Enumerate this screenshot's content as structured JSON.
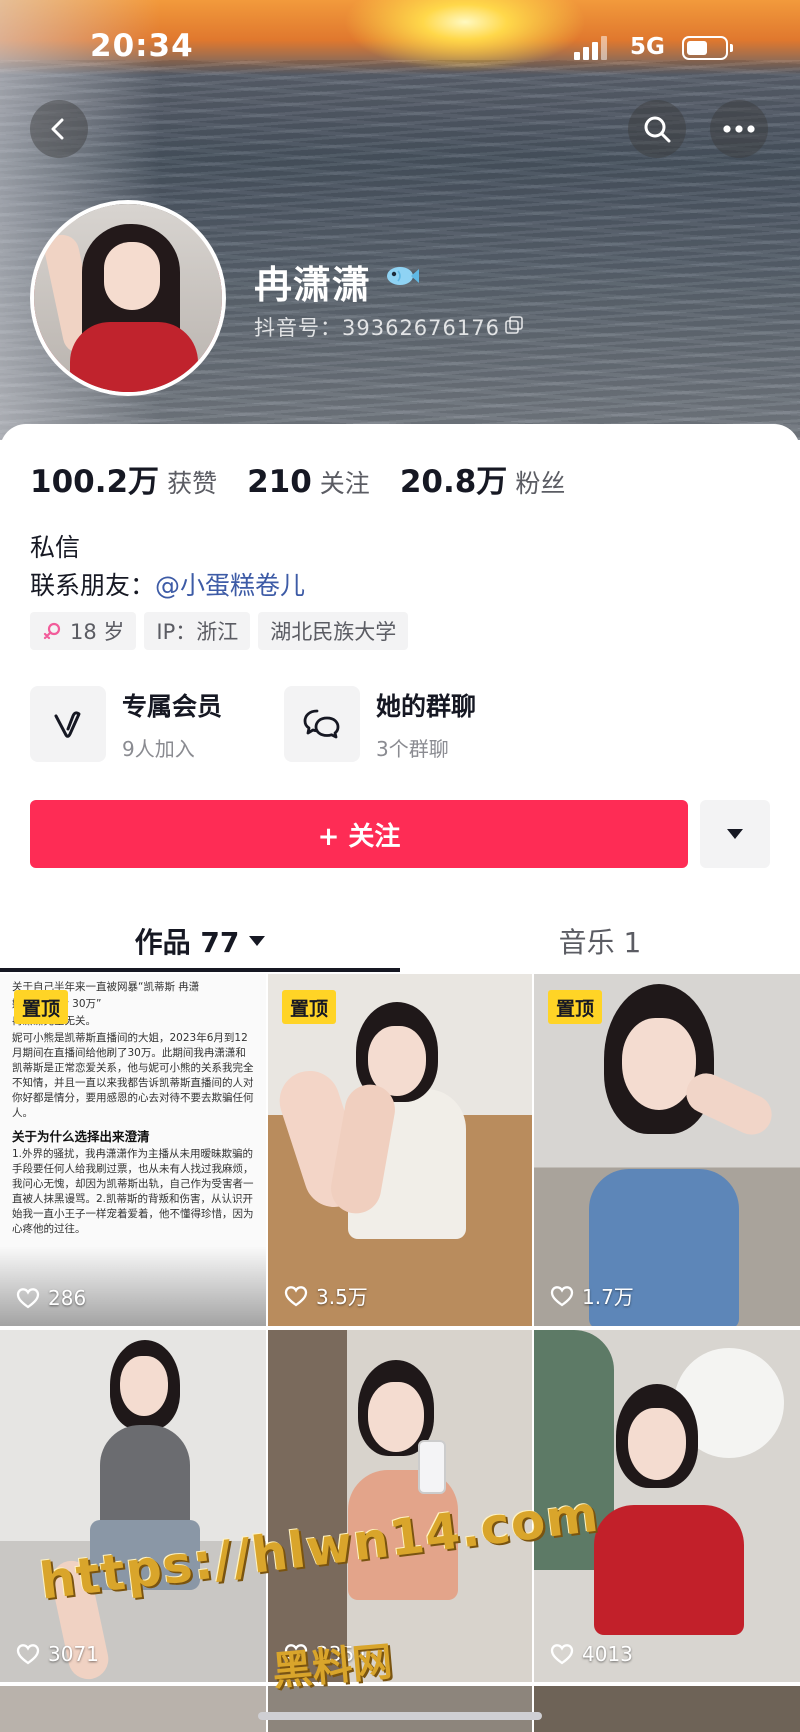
{
  "status_bar": {
    "time": "20:34",
    "network": "5G",
    "battery_level": 0.55
  },
  "profile": {
    "nickname": "冉潇潇",
    "douyin_id": "抖音号：39362676176",
    "stats": [
      {
        "value": "100.2万",
        "label": "获赞"
      },
      {
        "value": "210",
        "label": "关注"
      },
      {
        "value": "20.8万",
        "label": "粉丝"
      }
    ],
    "dm_label": "私信",
    "contact_prefix": "联系朋友：",
    "contact_handle": "@小蛋糕卷儿",
    "tags": {
      "age": "18 岁",
      "ip": "IP：浙江",
      "school": "湖北民族大学"
    }
  },
  "features": {
    "member": {
      "title": "专属会员",
      "sub": "9人加入"
    },
    "group": {
      "title": "她的群聊",
      "sub": "3个群聊"
    }
  },
  "actions": {
    "follow_label": "+ 关注"
  },
  "tabs": {
    "works": "作品 77",
    "music": "音乐 1"
  },
  "grid": {
    "pin_label": "置顶",
    "items": [
      {
        "likes": "286",
        "pinned": true
      },
      {
        "likes": "3.5万",
        "pinned": true
      },
      {
        "likes": "1.7万",
        "pinned": true
      },
      {
        "likes": "3071",
        "pinned": false
      },
      {
        "likes": "2354",
        "pinned": false
      },
      {
        "likes": "4013",
        "pinned": false
      }
    ],
    "doc_text": {
      "line1": "关于自己半年来一直被网暴“凯蒂斯 冉潇",
      "line2": "妮可小熊yw 30万”",
      "line3": "冉潇潇完全无关。",
      "para1": "妮可小熊是凯蒂斯直播间的大姐，2023年6月到12月期间在直播间给他刷了30万。此期间我冉潇潇和凯蒂斯是正常恋爱关系，他与妮可小熊的关系我完全不知情，并且一直以来我都告诉凯蒂斯直播间的人对你好都是情分，要用感恩的心去对待不要去欺骗任何人。",
      "heading": "关于为什么选择出来澄清",
      "para2": "1.外界的骚扰，我冉潇潇作为主播从未用暧昧欺骗的手段要任何人给我刷过票，也从未有人找过我麻烦，我问心无愧，却因为凯蒂斯出轨，自己作为受害者一直被人抹黑谩骂。2.凯蒂斯的背叛和伤害，从认识开始我一直小王子一样宠着爱着，他不懂得珍惜，因为心疼他的过往。"
    }
  },
  "watermark": {
    "url": "https://hlwn14.com",
    "site": "黑料网"
  },
  "colors": {
    "follow_red": "#fe2c55",
    "pin_yellow": "#ffd426",
    "link_blue": "#3d5ba6"
  }
}
